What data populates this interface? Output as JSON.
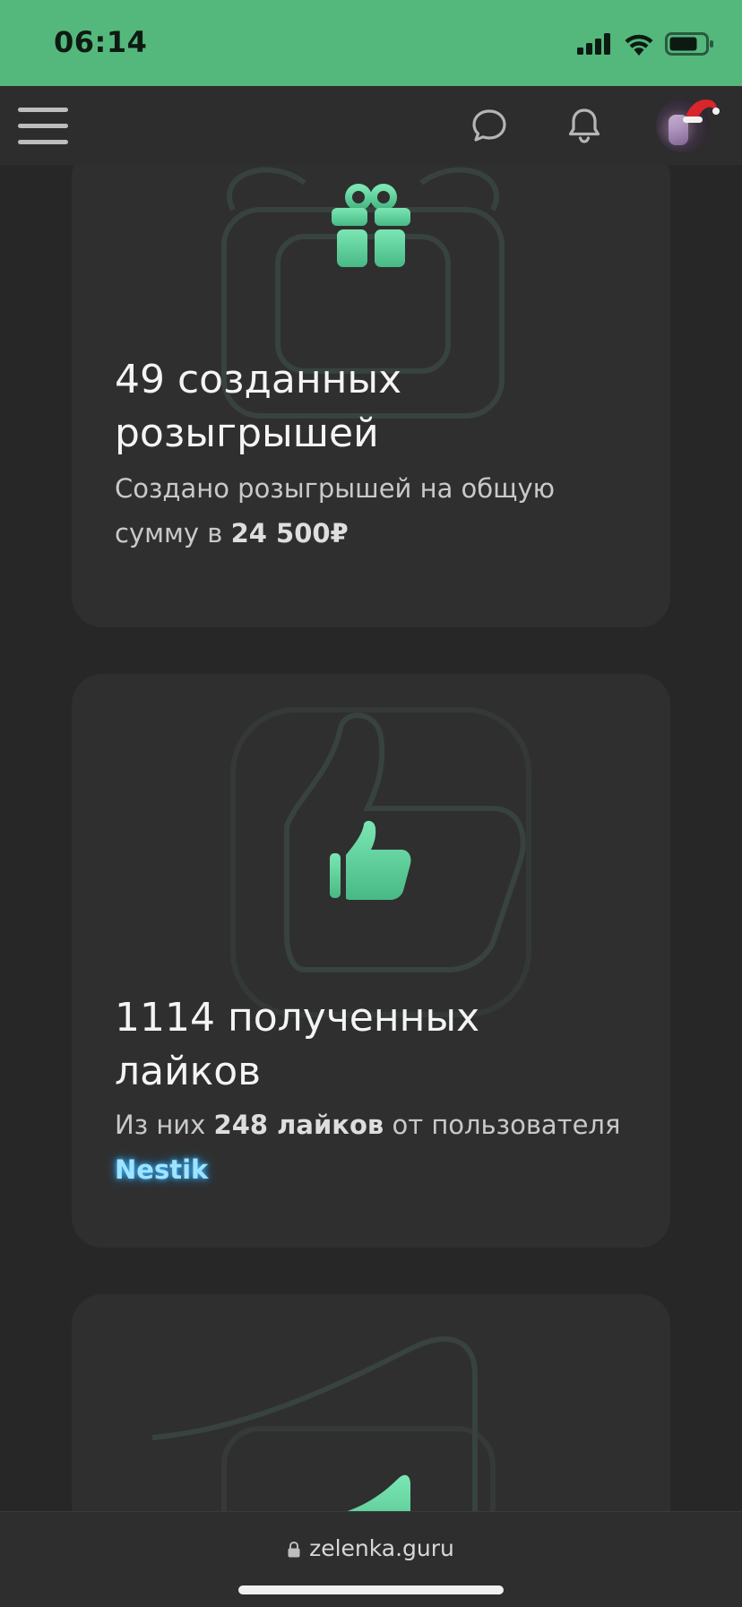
{
  "status_bar": {
    "time": "06:14"
  },
  "nav": {
    "menu_icon": "hamburger-menu-icon",
    "chat_icon": "chat-bubble-icon",
    "bell_icon": "notification-bell-icon"
  },
  "cards": [
    {
      "icon": "gift-icon",
      "title_line1": "49 созданных",
      "title_line2": "розыгрышей",
      "desc_line1": "Создано розыгрышей на общую",
      "desc_prefix": "сумму в ",
      "desc_amount": "24 500₽"
    },
    {
      "icon": "thumbs-up-icon",
      "title_line1": "1114 полученных",
      "title_line2": "лайков",
      "desc_prefix": "Из них ",
      "desc_count": "248 лайков",
      "desc_suffix": " от пользователя",
      "desc_user": "Nestik"
    },
    {
      "icon": "chart-icon"
    }
  ],
  "url_bar": {
    "url": "zelenka.guru"
  },
  "colors": {
    "status_bar": "#54b87d",
    "accent_green": "#5cd39a",
    "background": "#272727",
    "card": "#2f2f2f",
    "user_link": "#9fe3ff"
  }
}
